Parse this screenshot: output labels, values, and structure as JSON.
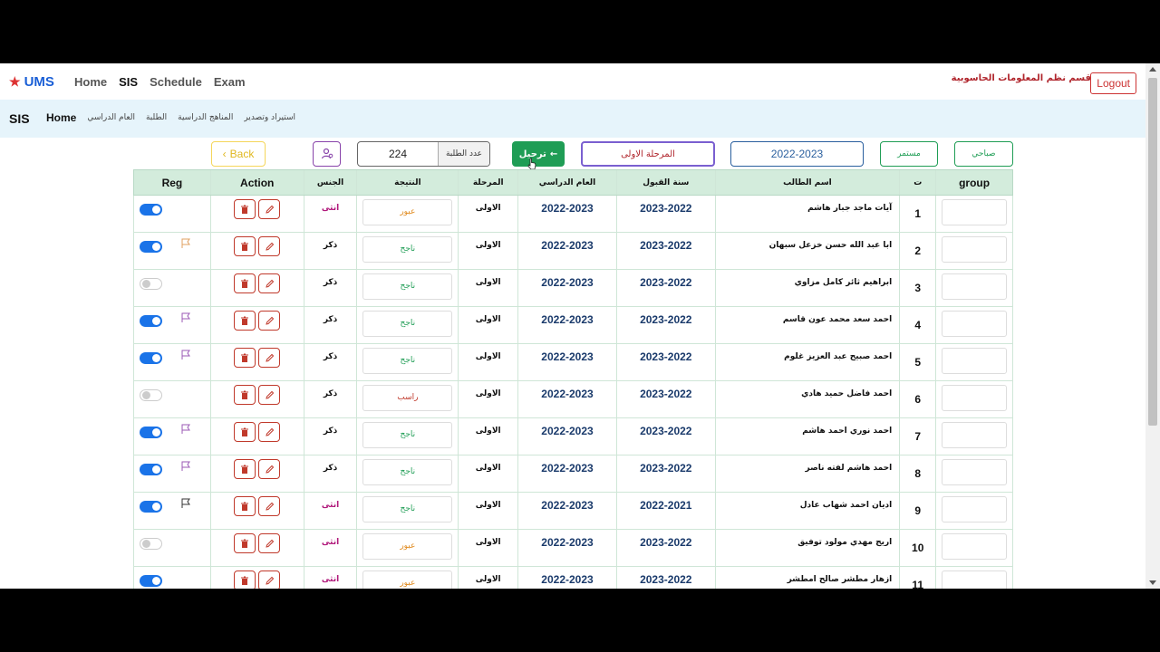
{
  "nav": {
    "brand": "UMS",
    "links": [
      "Home",
      "SIS",
      "Schedule",
      "Exam"
    ],
    "department": "قسم نظم المعلومات الحاسوبية",
    "logout": "Logout"
  },
  "subnav": {
    "title": "SIS",
    "links": [
      "Home",
      "العام الدراسي",
      "الطلبة",
      "المناهج الدراسية",
      "استيراد وتصدير"
    ]
  },
  "controls": {
    "back": "Back",
    "student_count": "224",
    "student_count_label": "عدد الطلبة",
    "transfer": "ترحيل",
    "stage": "المرحلة الاولى",
    "year": "2022-2023",
    "study": "مستمر",
    "shift": "صباحي"
  },
  "table": {
    "headers": {
      "reg": "Reg",
      "action": "Action",
      "sex": "الجنس",
      "result": "النتيجة",
      "stage": "المرحلة",
      "year": "العام الدراسي",
      "admission": "سنة القبول",
      "name": "اسم الطالب",
      "no": "ت",
      "group": "group"
    },
    "rows": [
      {
        "no": "1",
        "name": "آيات ماجد جبار هاشم",
        "admission": "2023-2022",
        "year": "2022-2023",
        "stage": "الاولى",
        "result": "عبور",
        "sex": "انثى",
        "reg": true,
        "flag": "none"
      },
      {
        "no": "2",
        "name": "ابا عبد الله حسن خزعل سبهان",
        "admission": "2023-2022",
        "year": "2022-2023",
        "stage": "الاولى",
        "result": "ناجح",
        "sex": "ذكر",
        "reg": true,
        "flag": "orange"
      },
      {
        "no": "3",
        "name": "ابراهيم ثائر كامل مزاوي",
        "admission": "2023-2022",
        "year": "2022-2023",
        "stage": "الاولى",
        "result": "ناجح",
        "sex": "ذكر",
        "reg": false,
        "flag": "none"
      },
      {
        "no": "4",
        "name": "احمد سعد محمد عون قاسم",
        "admission": "2023-2022",
        "year": "2022-2023",
        "stage": "الاولى",
        "result": "ناجح",
        "sex": "ذكر",
        "reg": true,
        "flag": "purple"
      },
      {
        "no": "5",
        "name": "احمد صبيح عبد العزيز غلوم",
        "admission": "2023-2022",
        "year": "2022-2023",
        "stage": "الاولى",
        "result": "ناجح",
        "sex": "ذكر",
        "reg": true,
        "flag": "purple"
      },
      {
        "no": "6",
        "name": "احمد فاضل حميد هادي",
        "admission": "2023-2022",
        "year": "2022-2023",
        "stage": "الاولى",
        "result": "راسب",
        "sex": "ذكر",
        "reg": false,
        "flag": "none"
      },
      {
        "no": "7",
        "name": "احمد نوري احمد هاشم",
        "admission": "2023-2022",
        "year": "2022-2023",
        "stage": "الاولى",
        "result": "ناجح",
        "sex": "ذكر",
        "reg": true,
        "flag": "purple"
      },
      {
        "no": "8",
        "name": "احمد هاشم لفته ناصر",
        "admission": "2023-2022",
        "year": "2022-2023",
        "stage": "الاولى",
        "result": "ناجح",
        "sex": "ذكر",
        "reg": true,
        "flag": "purple"
      },
      {
        "no": "9",
        "name": "اديان احمد شهاب عادل",
        "admission": "2022-2021",
        "year": "2022-2023",
        "stage": "الاولى",
        "result": "ناجح",
        "sex": "انثى",
        "reg": true,
        "flag": "dark"
      },
      {
        "no": "10",
        "name": "اريج مهدي مولود توفيق",
        "admission": "2023-2022",
        "year": "2022-2023",
        "stage": "الاولى",
        "result": "عبور",
        "sex": "انثى",
        "reg": false,
        "flag": "none"
      },
      {
        "no": "11",
        "name": "ازهار مطشر صالح امطشر",
        "admission": "2023-2022",
        "year": "2022-2023",
        "stage": "الاولى",
        "result": "عبور",
        "sex": "انثى",
        "reg": true,
        "flag": "none"
      }
    ]
  },
  "colors": {
    "header_bg": "#d3ecdc",
    "subnav_bg": "#e6f4fb",
    "toggle_on": "#1a73e8",
    "transfer_bg": "#1f9d55",
    "danger": "#c0392b"
  }
}
